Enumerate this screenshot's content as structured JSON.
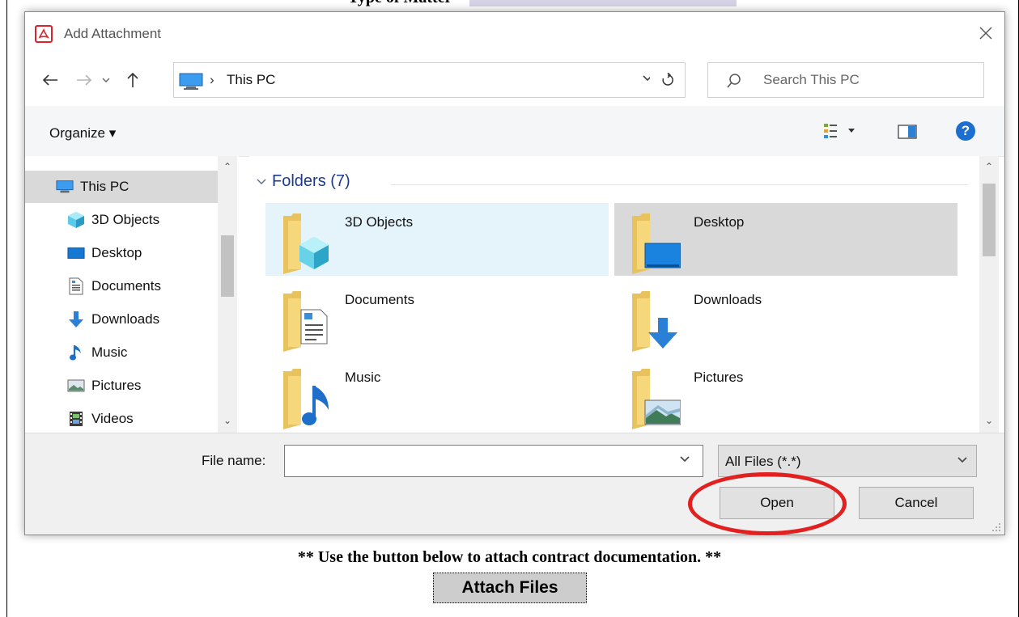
{
  "background_page": {
    "top_text_fragment": "Type of Matter",
    "note": "** Use the button below to attach contract documentation. **",
    "attach_button_label": "Attach Files"
  },
  "dialog": {
    "title": "Add Attachment",
    "address": {
      "separator": "›",
      "location": "This PC"
    },
    "search": {
      "placeholder": "Search This PC"
    },
    "command_bar": {
      "organize_label": "Organize ▾"
    },
    "nav_pane": {
      "items": [
        {
          "label": "This PC",
          "icon": "pc-icon"
        },
        {
          "label": "3D Objects",
          "icon": "cube-icon"
        },
        {
          "label": "Desktop",
          "icon": "desktop-icon"
        },
        {
          "label": "Documents",
          "icon": "document-icon"
        },
        {
          "label": "Downloads",
          "icon": "download-arrow-icon"
        },
        {
          "label": "Music",
          "icon": "music-note-icon"
        },
        {
          "label": "Pictures",
          "icon": "picture-icon"
        },
        {
          "label": "Videos",
          "icon": "film-icon"
        }
      ]
    },
    "content": {
      "group_header": "Folders (7)",
      "folders": [
        {
          "label": "3D Objects"
        },
        {
          "label": "Desktop"
        },
        {
          "label": "Documents"
        },
        {
          "label": "Downloads"
        },
        {
          "label": "Music"
        },
        {
          "label": "Pictures"
        }
      ]
    },
    "bottom": {
      "file_name_label": "File name:",
      "file_name_value": "",
      "file_type_filter": "All Files (*.*)",
      "open_label": "Open",
      "cancel_label": "Cancel"
    }
  },
  "colors": {
    "accent_blue": "#1c6ecf",
    "hover_tile": "#e5f3fb",
    "selected_tile": "#d9d9d9",
    "annotation_red": "#e32020",
    "pdf_red": "#d9232e"
  }
}
